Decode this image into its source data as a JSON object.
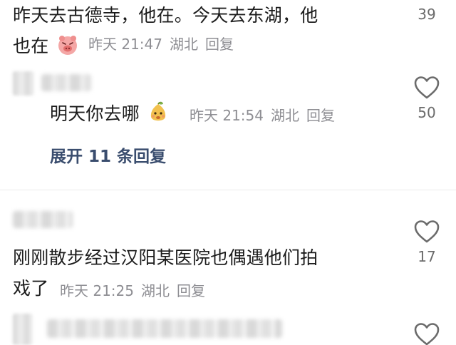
{
  "comments": [
    {
      "text_line1": "昨天去古德寺，他在。今天去东湖，他",
      "text_line2": "也在",
      "sticker": "pig-face-sticker",
      "time": "昨天 21:47",
      "location": "湖北",
      "reply_label": "回复",
      "like_count": "39"
    },
    {
      "is_reply": true,
      "text": "明天你去哪",
      "sticker": "pear-face-sticker",
      "time": "昨天 21:54",
      "location": "湖北",
      "reply_label": "回复",
      "like_count": "50",
      "expand_label": "展开 11 条回复"
    },
    {
      "text_line1": "刚刚散步经过汉阳某医院也偶遇他们拍",
      "text_line2": "戏了",
      "time": "昨天 21:25",
      "location": "湖北",
      "reply_label": "回复",
      "like_count": "17"
    }
  ],
  "icons": {
    "like": "heart-outline-icon"
  },
  "colors": {
    "text": "#1c1c1c",
    "meta": "#8e8e93",
    "expand": "#3a4d6e",
    "heart": "#6b6b6b"
  }
}
